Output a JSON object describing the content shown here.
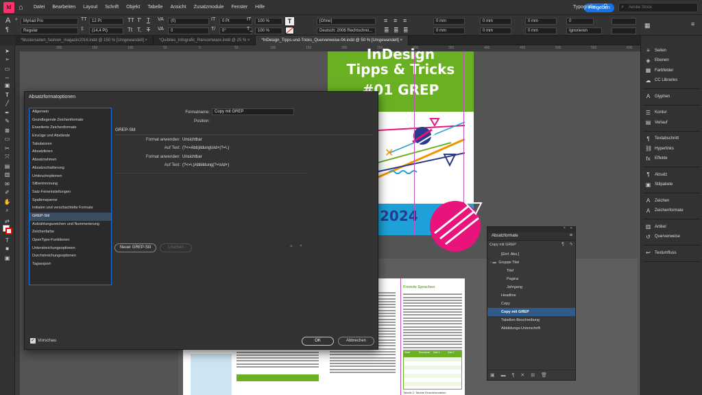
{
  "app": {
    "logo": "Id",
    "menu": [
      "Datei",
      "Bearbeiten",
      "Layout",
      "Schrift",
      "Objekt",
      "Tabelle",
      "Ansicht",
      "Zusatzmodule",
      "Fenster",
      "Hilfe"
    ],
    "share_label": "Freigeben",
    "workspace_label": "Typografie",
    "search_placeholder": "Adobe Stock"
  },
  "control": {
    "font_family": "Myriad Pro",
    "font_style": "Regular",
    "font_size": "12 Pt",
    "leading": "(14,4 Pt)",
    "kerning": "(0)",
    "tracking": "0",
    "baseline": "0 Pt",
    "angle": "0°",
    "scale_v": "100 %",
    "scale_h": "100 %",
    "char_style": "[Ohne]",
    "language": "Deutsch: 2006 Rechtschrei...",
    "indent1": "0 mm",
    "indent2": "0 mm",
    "indent3": "0 mm",
    "indent4": "0 mm",
    "space1": "0 mm",
    "space2": "0 mm",
    "hyph": "0",
    "ignore": "Ignorieren"
  },
  "tabs": [
    {
      "label": "*Musterseiten_fashion_magazin2016.indd @ 150 % [Umgewandelt]",
      "active": false
    },
    {
      "label": "*Quibitec_Infografic_Ransomware.indd @ 25 %",
      "active": false
    },
    {
      "label": "*InDesign_Tipps-und-Tricks_Querverweise-04.indd @ 50 % [Umgewandelt]",
      "active": true
    }
  ],
  "ruler_ticks": [
    "200",
    "150",
    "100",
    "50",
    "0",
    "50",
    "100",
    "150",
    "200",
    "250",
    "300",
    "350",
    "400",
    "450",
    "500",
    "550",
    "600"
  ],
  "right_panel": {
    "groups": [
      [
        {
          "icon": "≡",
          "label": "Seiten"
        },
        {
          "icon": "◈",
          "label": "Ebenen"
        },
        {
          "icon": "▦",
          "label": "Farbfelder"
        },
        {
          "icon": "☁",
          "label": "CC Libraries"
        }
      ],
      [
        {
          "icon": "A",
          "label": "Glyphen"
        }
      ],
      [
        {
          "icon": "☰",
          "label": "Kontur"
        },
        {
          "icon": "▤",
          "label": "Verlauf"
        }
      ],
      [
        {
          "icon": "¶",
          "label": "Textabschnitt"
        },
        {
          "icon": "⛓",
          "label": "Hyperlinks"
        },
        {
          "icon": "fx",
          "label": "Effekte"
        }
      ],
      [
        {
          "icon": "¶",
          "label": "Absatz"
        },
        {
          "icon": "▣",
          "label": "Stilpakete"
        }
      ],
      [
        {
          "icon": "A",
          "label": "Zeichen"
        },
        {
          "icon": "A",
          "label": "Zeichenformate"
        }
      ],
      [
        {
          "icon": "▥",
          "label": "Artikel"
        },
        {
          "icon": "↺",
          "label": "Querverweise"
        }
      ],
      [
        {
          "icon": "↩",
          "label": "Textumfluss"
        }
      ]
    ]
  },
  "dialog": {
    "title": "Absatzformatoptionen",
    "categories": [
      "Allgemein",
      "Grundlegende Zeichenformate",
      "Erweiterte Zeichenformate",
      "Einzüge und Abstände",
      "Tabulatoren",
      "Absatzlinien",
      "Absatzrahmen",
      "Absatzschattierung",
      "Umbruchoptionen",
      "Silbentrennung",
      "Satz-Feineinstellungen",
      "Spaltenspanne",
      "Initialen und verschachtelte Formate",
      "GREP-Stil",
      "Aufzählungszeichen und Nummerierung",
      "Zeichenfarbe",
      "OpenType-Funktionen",
      "Unterstreichungsoptionen",
      "Durchstreichungsoptionen",
      "Tagsexport"
    ],
    "selected_index": 13,
    "format_name_label": "Formatname:",
    "format_name_value": "Copy mit GREP",
    "position_label": "Position:",
    "section_title": "GREP-Stil",
    "styles": [
      {
        "apply_label": "Format anwenden:",
        "apply_value": "Unsichtbar",
        "text_label": "Auf Text:",
        "text_value": "(?<=Abb)ildung\\s\\d+(?=\\.)"
      },
      {
        "apply_label": "Format anwenden:",
        "apply_value": "Unsichtbar",
        "text_label": "Auf Text:",
        "text_value": "(?<=\\.)Abbildung(?=\\s\\d+)"
      }
    ],
    "new_button": "Neuer GREP-Stil",
    "delete_button": "Löschen",
    "preview_label": "Vorschau",
    "ok_label": "OK",
    "cancel_label": "Abbrechen"
  },
  "artwork": {
    "line1": "InDesign",
    "line2": "Tipps & Tricks",
    "line3": "#01 GREP",
    "year": "2024",
    "heading_right": "Fremde Sprachen",
    "table_headers": [
      "Stadt",
      "Einwohner",
      "Zahl 1",
      "Zahl 2"
    ],
    "caption": "Tabelle 2: Tabelle Einwohnerzahlen",
    "colors": {
      "green": "#6ab023",
      "blue": "#1ea1d8",
      "pink": "#e8147c",
      "orange": "#f29400",
      "navy": "#2a3a8c"
    }
  },
  "abs_panel": {
    "title": "Absatzformate",
    "current": "Copy mit GREP",
    "items": [
      {
        "label": "[Einf. Abs.]",
        "indent": 0,
        "selected": false
      },
      {
        "label": "Gruppe Titel",
        "indent": 0,
        "folder": true,
        "selected": false
      },
      {
        "label": "Titel",
        "indent": 1,
        "selected": false
      },
      {
        "label": "Pagina",
        "indent": 1,
        "selected": false
      },
      {
        "label": "Jahrgang",
        "indent": 1,
        "selected": false
      },
      {
        "label": "Headline",
        "indent": 0,
        "selected": false
      },
      {
        "label": "Copy",
        "indent": 0,
        "selected": false
      },
      {
        "label": "Copy mit GREP",
        "indent": 0,
        "selected": true
      },
      {
        "label": "Tabellen-Beschreibung",
        "indent": 0,
        "selected": false
      },
      {
        "label": "Abbildungs-Unterschrift",
        "indent": 0,
        "selected": false
      }
    ]
  }
}
